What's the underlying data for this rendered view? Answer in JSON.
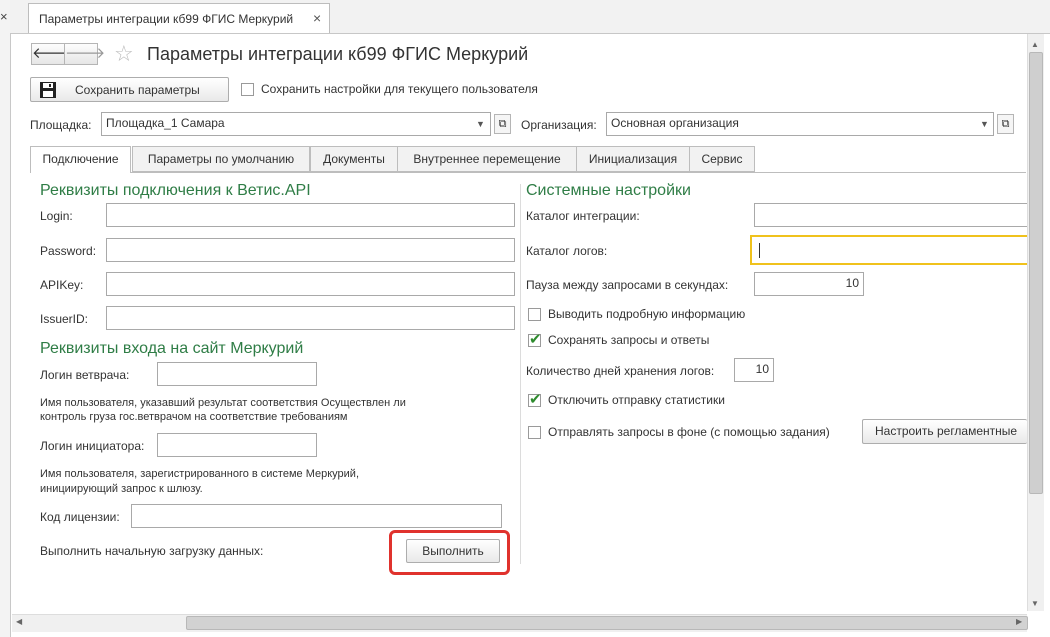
{
  "window_tab": {
    "title": "Параметры интеграции кб99 ФГИС Меркурий",
    "close": "×"
  },
  "parent_close": "×",
  "header": {
    "back": "🡐",
    "forward": "🡒",
    "title": "Параметры интеграции кб99 ФГИС Меркурий",
    "star": "☆"
  },
  "toolbar": {
    "save_label": "Сохранить параметры",
    "save_user_settings": "Сохранить настройки для текущего пользователя",
    "save_user_settings_checked": false
  },
  "site": {
    "label": "Площадка:",
    "value": "Площадка_1 Самара"
  },
  "organization": {
    "label": "Организация:",
    "value": "Основная организация"
  },
  "tabs": [
    {
      "label": "Подключение",
      "active": true
    },
    {
      "label": "Параметры по умолчанию",
      "active": false
    },
    {
      "label": "Документы",
      "active": false
    },
    {
      "label": "Внутреннее перемещение",
      "active": false
    },
    {
      "label": "Инициализация",
      "active": false
    },
    {
      "label": "Сервис",
      "active": false
    }
  ],
  "connection": {
    "title": "Реквизиты подключения к Ветис.API",
    "login": {
      "label": "Login:",
      "value": ""
    },
    "password": {
      "label": "Password:",
      "value": ""
    },
    "apikey": {
      "label": "APIKey:",
      "value": ""
    },
    "issuerid": {
      "label": "IssuerID:",
      "value": ""
    }
  },
  "mercury_login": {
    "title": "Реквизиты входа на сайт Меркурий",
    "vet_login": {
      "label": "Логин ветврача:",
      "value": ""
    },
    "vet_hint_1": "Имя пользователя, указавший результат соответствия Осуществлен ли",
    "vet_hint_2": "контроль груза гос.ветврачом на соответствие требованиям",
    "initiator_login": {
      "label": "Логин инициатора:",
      "value": ""
    },
    "init_hint_1": "Имя пользователя, зарегистрированного в системе Меркурий,",
    "init_hint_2": "инициирующий запрос к шлюзу."
  },
  "license": {
    "label": "Код лицензии:",
    "value": ""
  },
  "initial_load": {
    "label": "Выполнить начальную загрузку данных:",
    "button": "Выполнить"
  },
  "system": {
    "title": "Системные настройки",
    "integration_dir": {
      "label": "Каталог интеграции:",
      "value": ""
    },
    "log_dir": {
      "label": "Каталог логов:",
      "value": ""
    },
    "pause": {
      "label": "Пауза между запросами в секундах:",
      "value": "10"
    },
    "verbose": {
      "label": "Выводить подробную информацию",
      "checked": false
    },
    "save_requests": {
      "label": "Сохранять запросы и ответы",
      "checked": true
    },
    "log_days": {
      "label": "Количество дней хранения логов:",
      "value": "10"
    },
    "disable_stats": {
      "label": "Отключить отправку статистики",
      "checked": true
    },
    "background": {
      "label": "Отправлять запросы в фоне (с помощью задания)",
      "checked": false
    },
    "schedule_button": "Настроить регламентные"
  },
  "colors": {
    "section_title": "#2f7d46",
    "highlight": "#e0322d",
    "focus": "#f0c21c"
  }
}
